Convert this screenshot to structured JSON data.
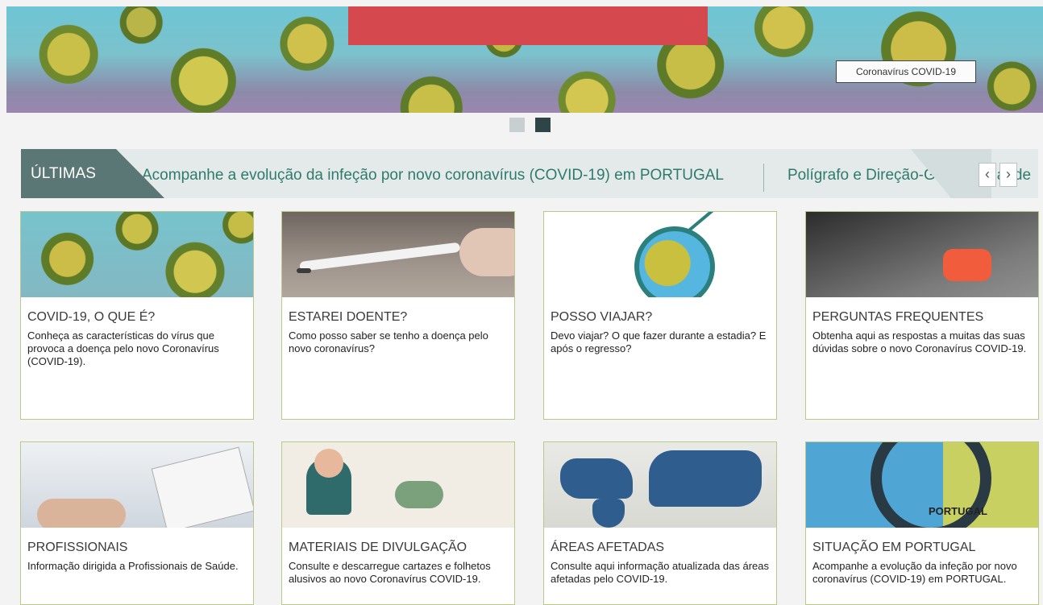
{
  "hero": {
    "tooltip": "Coronavírus COVID-19"
  },
  "ticker": {
    "label": "ÚLTIMAS",
    "item1": "Acompanhe a evolução da infeção por novo coronavírus (COVID-19) em PORTUGAL",
    "item2": "Polígrafo e Direção-Geral da Saúde",
    "prev_icon": "‹",
    "next_icon": "›"
  },
  "cards": [
    {
      "title": "COVID-19, O QUE É?",
      "desc": "Conheça as características do vírus que provoca a doença pelo novo Coronavírus (COVID-19)."
    },
    {
      "title": "ESTAREI DOENTE?",
      "desc": "Como posso saber se tenho a doença pelo novo coronavírus?"
    },
    {
      "title": "POSSO VIAJAR?",
      "desc": "Devo viajar? O que fazer durante a estadia? E após o regresso?"
    },
    {
      "title": "PERGUNTAS FREQUENTES",
      "desc": "Obtenha aqui as respostas a muitas das suas dúvidas sobre o novo Coronavírus COVID-19."
    },
    {
      "title": "PROFISSIONAIS",
      "desc": "Informação dirigida a Profissionais de Saúde."
    },
    {
      "title": "MATERIAIS DE DIVULGAÇÃO",
      "desc": "Consulte e descarregue cartazes e folhetos alusivos ao novo Coronavírus COVID-19."
    },
    {
      "title": "ÁREAS AFETADAS",
      "desc": "Consulte aqui informação atualizada das áreas afetadas pelo COVID-19."
    },
    {
      "title": "SITUAÇÃO EM PORTUGAL",
      "desc": "Acompanhe a evolução da infeção por novo coronavírus (COVID-19) em PORTUGAL."
    }
  ],
  "images": {
    "portugal_label": "PORTUGAL"
  }
}
